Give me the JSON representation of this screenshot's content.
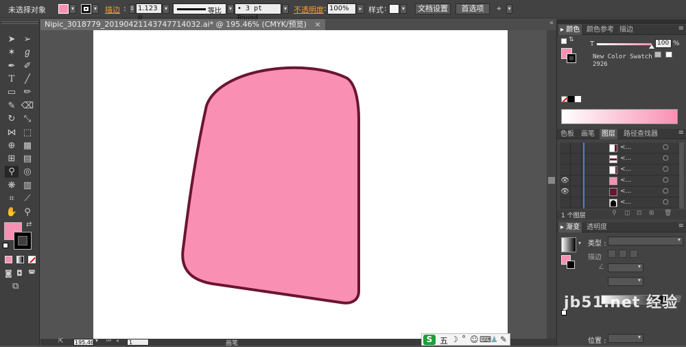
{
  "control_bar": {
    "selection_label": "未选择对象",
    "stroke_label": "描边",
    "stroke_weight": "1.123 p",
    "profile_label": "等比",
    "brush_label": "3 pt Round",
    "opacity_label": "不透明度",
    "opacity_value": "100%",
    "style_label": "样式",
    "doc_setup_button": "文档设置",
    "preferences_button": "首选项",
    "fill_color": "#f990b4"
  },
  "document": {
    "tab_title": "Nipic_3018779_20190421143747714032.ai* @ 195.46% (CMYK/预览)",
    "shape_fill": "#f990b4",
    "shape_stroke": "#6b1530"
  },
  "status_bar": {
    "zoom": "195.46",
    "page": "1",
    "tool_name": "画笔"
  },
  "ime_bar": {
    "items": [
      "S",
      "五",
      "☽",
      "°",
      "☺",
      "⌨",
      "♟",
      "✎"
    ]
  },
  "color_panel": {
    "tabs": [
      "颜色",
      "颜色参考",
      "描边"
    ],
    "channel_label": "T",
    "tint_value": "100",
    "percent": "%",
    "swatch_name": "New Color Swatch",
    "swatch_number": "2926"
  },
  "layers_panel": {
    "tabs": [
      "色板",
      "画笔",
      "图层",
      "路径查找器"
    ],
    "rows": [
      {
        "name": "<...",
        "visible": false
      },
      {
        "name": "<...",
        "visible": false
      },
      {
        "name": "<...",
        "visible": false
      },
      {
        "name": "<...",
        "visible": true
      },
      {
        "name": "<...",
        "visible": true
      },
      {
        "name": "<...",
        "visible": false
      }
    ],
    "footer_count": "1 个图层"
  },
  "gradient_panel": {
    "tabs": [
      "渐变",
      "透明度"
    ],
    "type_label": "类型",
    "stroke_label": "描边",
    "position_label": "位置"
  },
  "watermark": "jb51.net 经验"
}
